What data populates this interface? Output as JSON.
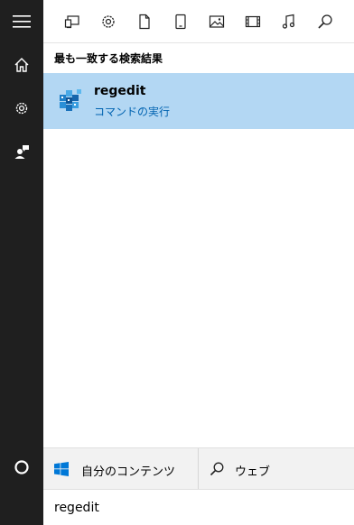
{
  "rail": {
    "items": [
      "hamburger-menu",
      "home",
      "settings",
      "feedback"
    ],
    "cortana": "cortana-circle"
  },
  "filters": [
    "apps",
    "settings",
    "documents",
    "tablet-device",
    "photos",
    "videos",
    "music",
    "search"
  ],
  "results": {
    "header": "最も一致する検索結果",
    "best_match": {
      "title": "regedit",
      "subtitle": "コマンドの実行",
      "icon": "registry-editor-icon"
    }
  },
  "scope": {
    "mine_label": "自分のコンテンツ",
    "web_label": "ウェブ"
  },
  "search": {
    "value": "regedit"
  },
  "colors": {
    "rail_bg": "#1f1f1f",
    "selection_bg": "#b3d7f3",
    "accent": "#0063b1"
  }
}
